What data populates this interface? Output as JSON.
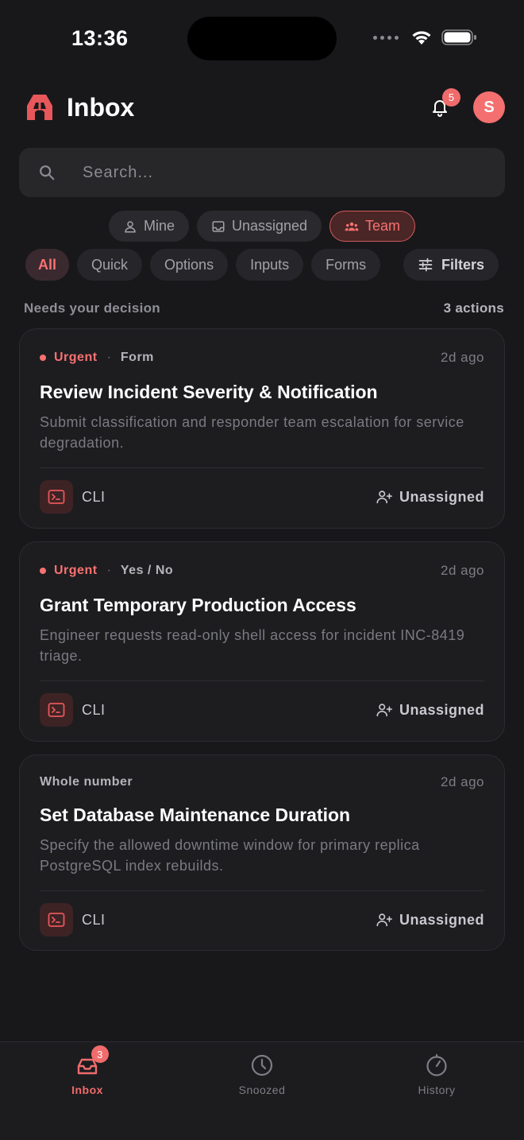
{
  "status_bar": {
    "time": "13:36"
  },
  "header": {
    "title": "Inbox",
    "notification_count": "5",
    "avatar_initial": "S"
  },
  "search": {
    "placeholder": "Search..."
  },
  "scope_tabs": [
    {
      "label": "Mine",
      "icon": "user-icon",
      "active": false
    },
    {
      "label": "Unassigned",
      "icon": "inbox-tray-icon",
      "active": false
    },
    {
      "label": "Team",
      "icon": "team-icon",
      "active": true
    }
  ],
  "type_filters": [
    {
      "label": "All",
      "active": true
    },
    {
      "label": "Quick",
      "active": false
    },
    {
      "label": "Options",
      "active": false
    },
    {
      "label": "Inputs",
      "active": false
    },
    {
      "label": "Forms",
      "active": false
    }
  ],
  "filters_button": {
    "label": "Filters",
    "icon": "sliders-icon"
  },
  "section": {
    "title": "Needs your decision",
    "count": "3 actions"
  },
  "cards": [
    {
      "urgent": "Urgent",
      "type": "Form",
      "age": "2d ago",
      "title": "Review Incident Severity & Notification",
      "description": "Submit classification and responder team escalation for service degradation.",
      "source": "CLI",
      "assignee": "Unassigned"
    },
    {
      "urgent": "Urgent",
      "type": "Yes / No",
      "age": "2d ago",
      "title": "Grant Temporary Production Access",
      "description": "Engineer requests read-only shell access for incident INC-8419 triage.",
      "source": "CLI",
      "assignee": "Unassigned"
    },
    {
      "urgent": "",
      "type": "Whole number",
      "age": "2d ago",
      "title": "Set Database Maintenance Duration",
      "description": "Specify the allowed downtime window for primary replica PostgreSQL index rebuilds.",
      "source": "CLI",
      "assignee": "Unassigned"
    }
  ],
  "bottom_nav": [
    {
      "label": "Inbox",
      "icon": "inbox-icon",
      "badge": "3",
      "active": true
    },
    {
      "label": "Snoozed",
      "icon": "clock-icon",
      "active": false
    },
    {
      "label": "History",
      "icon": "history-icon",
      "active": false
    }
  ],
  "colors": {
    "accent": "#f06b6b",
    "background": "#18181b",
    "card": "#1d1d20"
  }
}
